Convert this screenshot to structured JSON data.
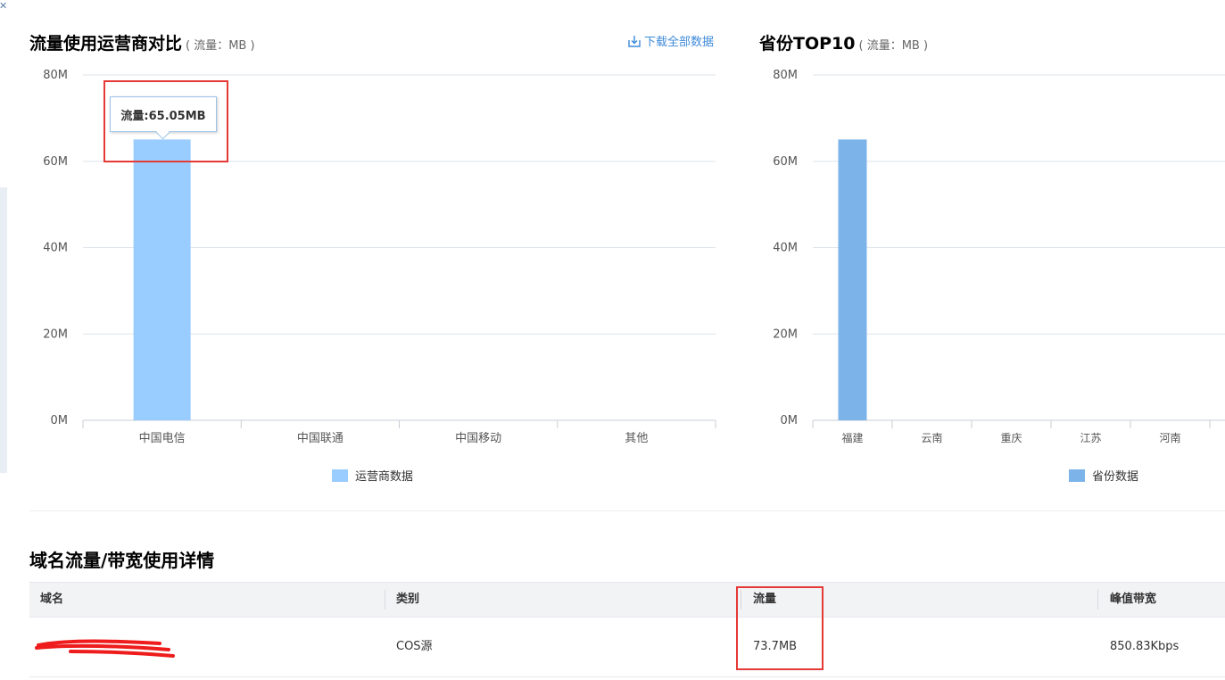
{
  "left_panel": {
    "title": "流量使用运营商对比",
    "unit": "( 流量：MB )",
    "download_label": "下载全部数据"
  },
  "right_panel": {
    "title": "省份TOP10",
    "unit": "( 流量：MB )"
  },
  "tooltip": {
    "text": "流量:65.05MB"
  },
  "colors": {
    "bar_light": "#99ccff",
    "bar_mid": "#7cb4ea",
    "grid": "#dde3ea",
    "link": "#3d8ad9",
    "highlight": "#e53935"
  },
  "chart_data": [
    {
      "type": "bar",
      "categories": [
        "中国电信",
        "中国联通",
        "中国移动",
        "其他"
      ],
      "series": [
        {
          "name": "运营商数据",
          "values": [
            65.05,
            0,
            0,
            0
          ]
        }
      ],
      "yticks": [
        "0M",
        "20M",
        "40M",
        "60M",
        "80M"
      ],
      "ylim": [
        0,
        80
      ],
      "grid": true,
      "legend_position": "bottom-center"
    },
    {
      "type": "bar",
      "categories": [
        "福建",
        "云南",
        "重庆",
        "江苏",
        "河南"
      ],
      "series": [
        {
          "name": "省份数据",
          "values": [
            65.05,
            0,
            0,
            0,
            0
          ]
        }
      ],
      "yticks": [
        "0M",
        "20M",
        "40M",
        "60M",
        "80M"
      ],
      "ylim": [
        0,
        80
      ],
      "grid": true,
      "legend_position": "bottom-center"
    }
  ],
  "details": {
    "title": "域名流量/带宽使用详情",
    "columns": [
      "域名",
      "类别",
      "流量",
      "峰值带宽"
    ],
    "rows": [
      {
        "domain": "",
        "category": "COS源",
        "traffic": "73.7MB",
        "peak_bandwidth": "850.83Kbps"
      }
    ]
  }
}
